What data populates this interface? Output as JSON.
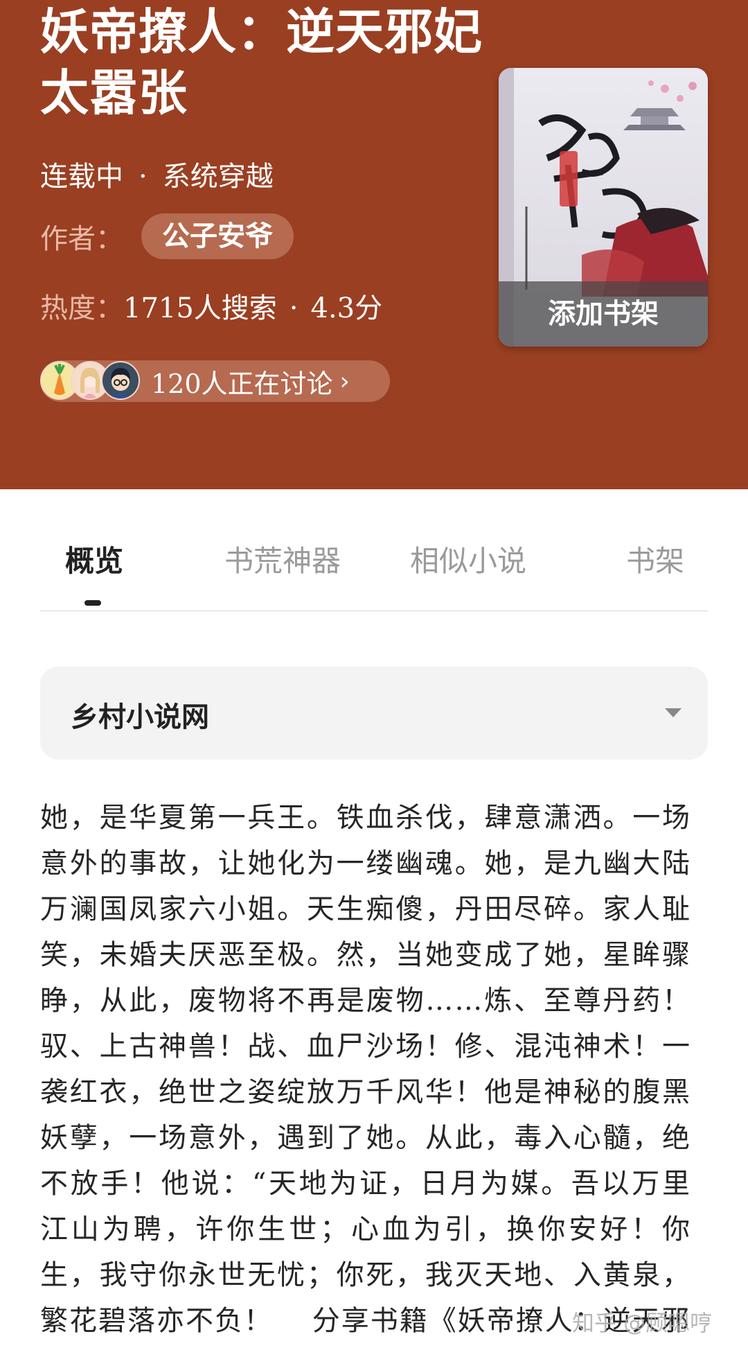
{
  "header": {
    "title": "妖帝撩人：逆天邪妃太嚣张",
    "status": "连载中",
    "separator": "·",
    "category": "系统穿越",
    "author_label": "作者：",
    "author_name": "公子安爷",
    "heat_label": "热度：",
    "heat_value": "1715人搜索",
    "score": "4.3分",
    "discussion_text": "120人正在讨论",
    "add_shelf_label": "添加书架"
  },
  "colors": {
    "header_bg": "#9a3f22",
    "chip_bg": "#b66a50",
    "active_tab": "#222222",
    "inactive_tab": "#9a9a9a"
  },
  "tabs": [
    {
      "label": "概览",
      "active": true
    },
    {
      "label": "书荒神器",
      "active": false
    },
    {
      "label": "相似小说",
      "active": false
    },
    {
      "label": "书架",
      "active": false
    }
  ],
  "source": {
    "selected": "乡村小说网",
    "icon": "chevron-down-icon"
  },
  "synopsis": "她，是华夏第一兵王。铁血杀伐，肆意潇洒。一场意外的事故，让她化为一缕幽魂。她，是九幽大陆万澜国凤家六小姐。天生痴傻，丹田尽碎。家人耻笑，未婚夫厌恶至极。然，当她变成了她，星眸骤睁，从此，废物将不再是废物……炼、至尊丹药！驭、上古神兽！战、血尸沙场！修、混沌神术！一袭红衣，绝世之姿绽放万千风华！他是神秘的腹黑妖孽，一场意外，遇到了她。从此，毒入心髓，绝不放手！他说：“天地为证，日月为媒。吾以万里江山为聘，许你生世；心血为引，换你安好！你生，我守你永世无忧；你死，我灭天地、入黄泉，繁花碧落亦不负！　 分享书籍《妖帝撩人：逆天邪",
  "watermark": "知乎 @顾嗯哼"
}
